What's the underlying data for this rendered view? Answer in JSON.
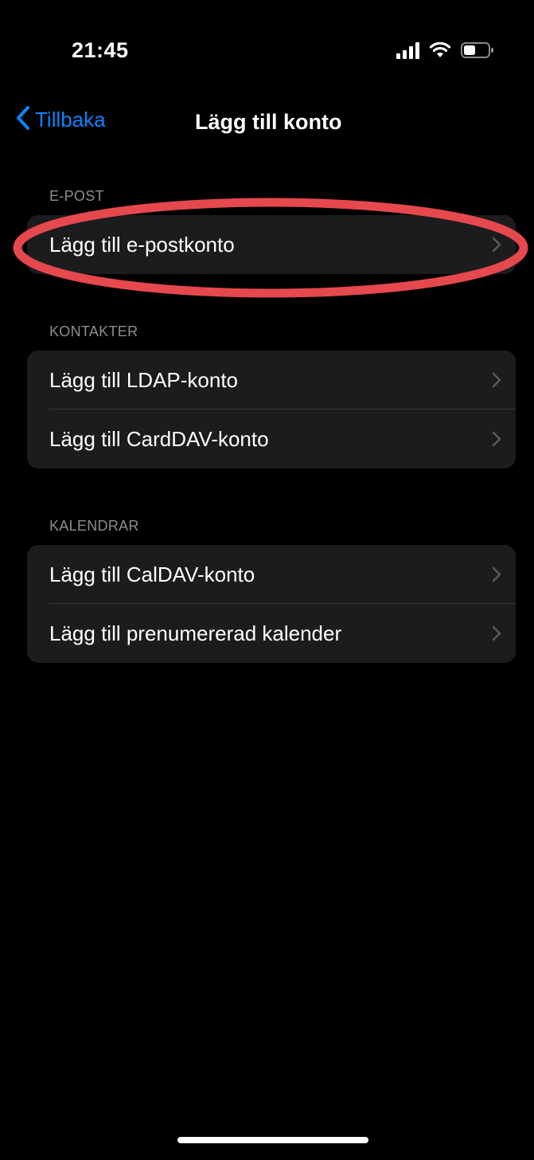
{
  "status_bar": {
    "time": "21:45",
    "icons": [
      "signal-icon",
      "wifi-icon",
      "battery-icon"
    ]
  },
  "nav": {
    "back_label": "Tillbaka",
    "title": "Lägg till konto"
  },
  "sections": [
    {
      "header": "E-POST",
      "items": [
        {
          "label": "Lägg till e-postkonto",
          "highlighted": true
        }
      ]
    },
    {
      "header": "KONTAKTER",
      "items": [
        {
          "label": "Lägg till LDAP-konto"
        },
        {
          "label": "Lägg till CardDAV-konto"
        }
      ]
    },
    {
      "header": "KALENDRAR",
      "items": [
        {
          "label": "Lägg till CalDAV-konto"
        },
        {
          "label": "Lägg till prenumererad kalender"
        }
      ]
    }
  ],
  "colors": {
    "background": "#000000",
    "group_background": "#1c1c1e",
    "accent": "#0a84ff",
    "section_header": "#8d8d93",
    "chevron": "#5a5a5e",
    "annotation": "#e5484d"
  }
}
